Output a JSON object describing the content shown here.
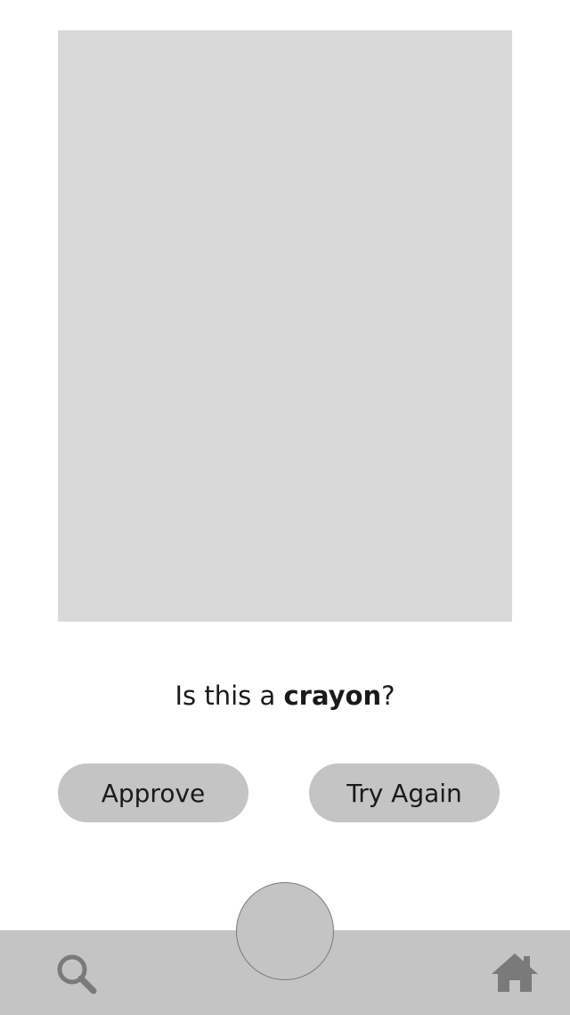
{
  "question": {
    "prefix": "Is this a ",
    "object": "crayon",
    "suffix": "?"
  },
  "buttons": {
    "approve_label": "Approve",
    "try_again_label": "Try Again"
  },
  "bottom_nav": {
    "left_icon": "search-icon",
    "center": "capture-button",
    "right_icon": "home-icon"
  },
  "colors": {
    "placeholder": "#d9d9d9",
    "button_fill": "#c4c4c4",
    "icon": "#7a7a7a",
    "text": "#1a1a1a"
  }
}
